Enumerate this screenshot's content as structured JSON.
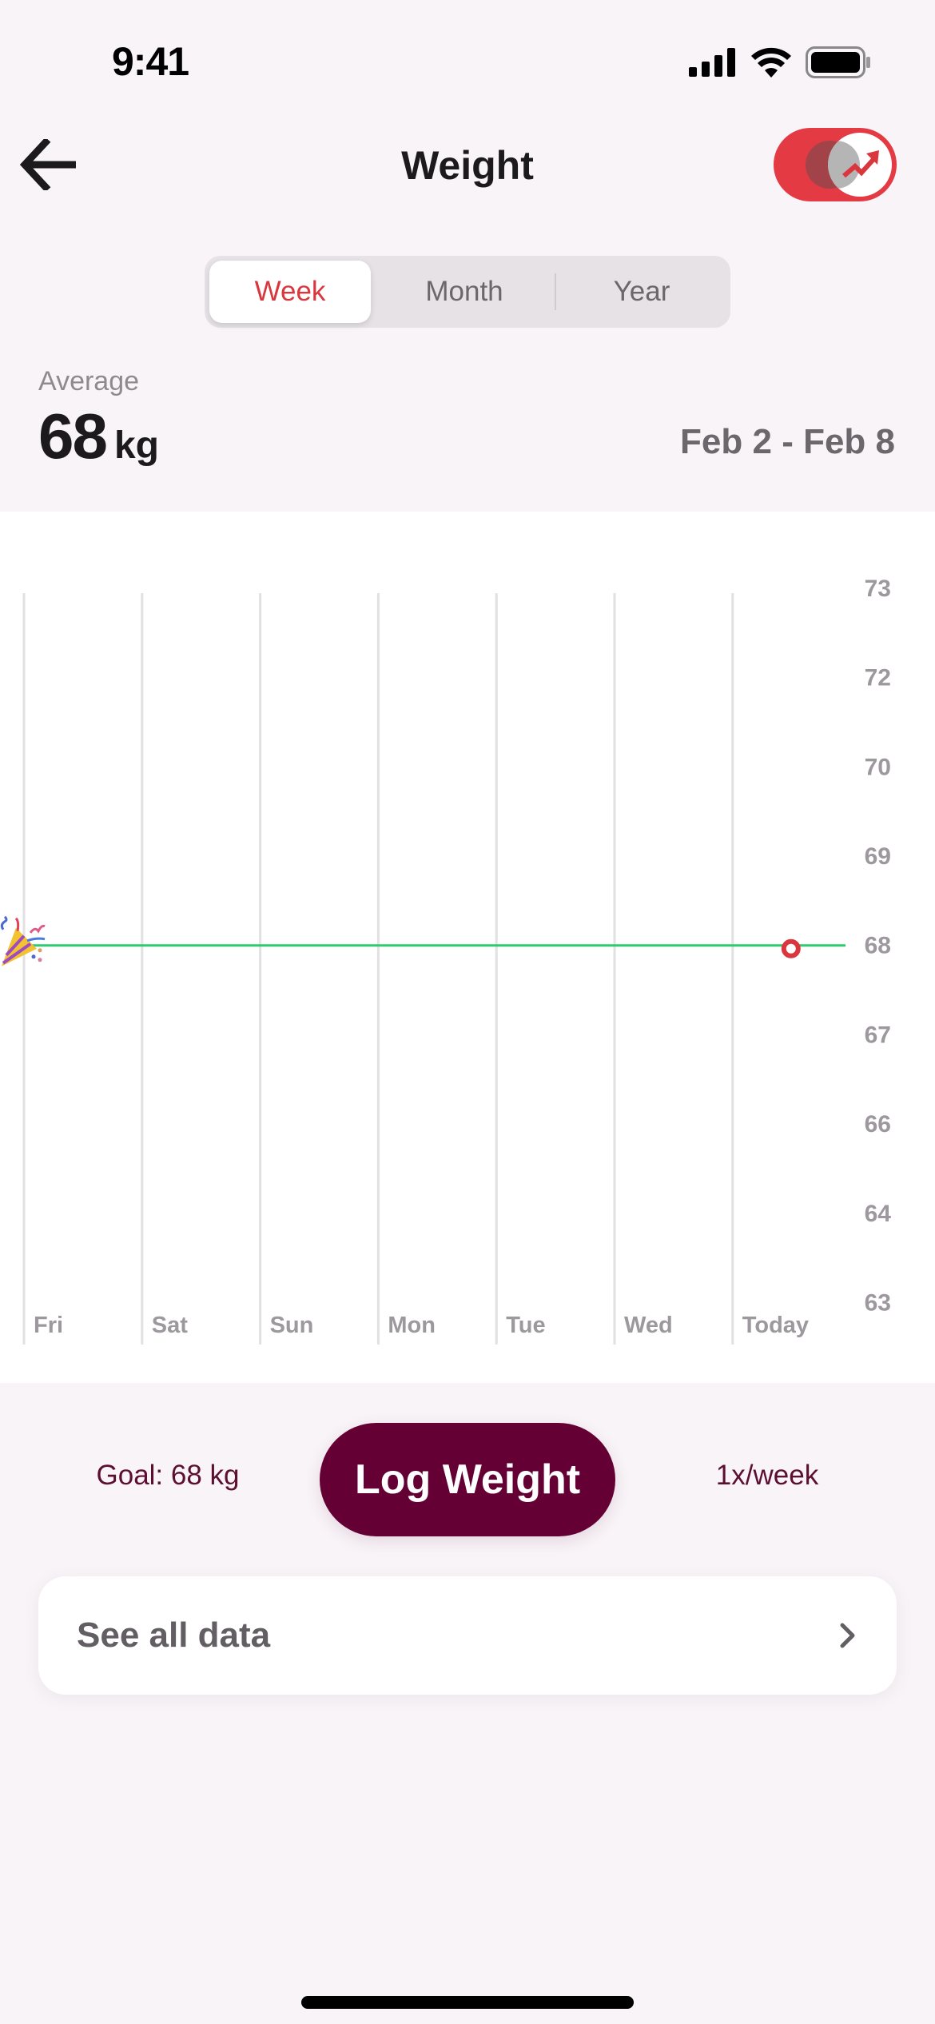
{
  "status_bar": {
    "time": "9:41",
    "icons": [
      "cellular-signal-icon",
      "wifi-icon",
      "battery-icon"
    ]
  },
  "header": {
    "back_icon": "arrow-left-icon",
    "title": "Weight",
    "trend_toggle": {
      "icon": "trending-up-icon",
      "state": "on",
      "color": "#e33a43"
    }
  },
  "segmented": {
    "options": [
      {
        "label": "Week",
        "selected": true
      },
      {
        "label": "Month",
        "selected": false
      },
      {
        "label": "Year",
        "selected": false
      }
    ],
    "accent": "#d9363e"
  },
  "summary": {
    "label": "Average",
    "value": "68",
    "unit": "kg",
    "date_range": "Feb 2 - Feb 8"
  },
  "chart_data": {
    "type": "line",
    "categories": [
      "Fri",
      "Sat",
      "Sun",
      "Mon",
      "Tue",
      "Wed",
      "Today"
    ],
    "y_tick_labels": [
      "73",
      "72",
      "70",
      "69",
      "68",
      "67",
      "66",
      "64",
      "63"
    ],
    "series": [
      {
        "name": "Weight",
        "points": [
          {
            "x": "Today",
            "y": 68
          }
        ],
        "marker_color": "#d9363e"
      }
    ],
    "goal_line": {
      "value": 68,
      "color": "#2ecc71",
      "icon": "party-popper-icon"
    },
    "title": "",
    "xlabel": "",
    "ylabel": "",
    "ylim": [
      63,
      73
    ],
    "grid": "vertical",
    "y_axis_side": "right"
  },
  "bottom": {
    "goal_text": "Goal: 68 kg",
    "log_button": "Log Weight",
    "frequency": "1x/week",
    "button_color": "#640033"
  },
  "see_all": {
    "label": "See all data",
    "icon": "chevron-right-icon"
  }
}
